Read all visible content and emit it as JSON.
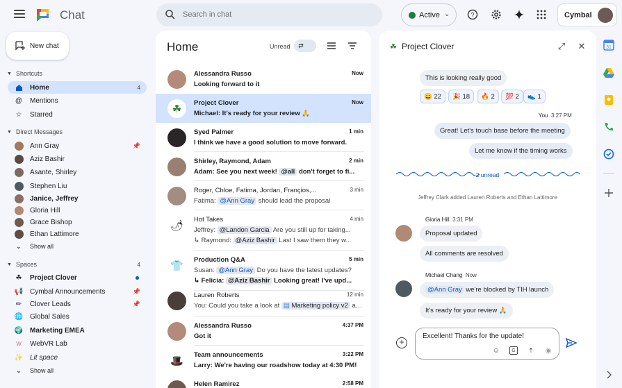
{
  "header": {
    "app_title": "Chat",
    "search_placeholder": "Search in chat",
    "status": "Active",
    "brand": "Cymbal",
    "icons": [
      "menu-icon",
      "help-icon",
      "settings-icon",
      "gemini-icon",
      "apps-grid-icon"
    ]
  },
  "sidebar": {
    "new_chat": "New chat",
    "shortcuts_label": "Shortcuts",
    "shortcuts": [
      {
        "label": "Home",
        "count": "4",
        "active": true
      },
      {
        "label": "Mentions"
      },
      {
        "label": "Starred"
      }
    ],
    "dm_label": "Direct Messages",
    "dms": [
      {
        "label": "Ann Gray",
        "pinned": true
      },
      {
        "label": "Aziz Bashir"
      },
      {
        "label": "Asante, Shirley"
      },
      {
        "label": "Stephen Liu"
      },
      {
        "label": "Janice, Jeffrey",
        "bold": true
      },
      {
        "label": "Gloria Hill"
      },
      {
        "label": "Grace Bishop"
      },
      {
        "label": "Ethan Lattimore"
      },
      {
        "label": "Show all"
      }
    ],
    "spaces_label": "Spaces",
    "spaces_count": "4",
    "spaces": [
      {
        "label": "Project Clover",
        "bold": true
      },
      {
        "label": "Cymbal Announcements",
        "pinned": true
      },
      {
        "label": "Clover Leads",
        "pinned": true
      },
      {
        "label": "Global Sales"
      },
      {
        "label": "Marketing EMEA",
        "bold": true
      },
      {
        "label": "WebVR Lab"
      },
      {
        "label": "Lit space",
        "italic": true
      },
      {
        "label": "Show all"
      }
    ]
  },
  "home": {
    "title": "Home",
    "unread_label": "Unread",
    "conversations": [
      {
        "name": "Alessandra Russo",
        "time": "Now",
        "snippet": "Looking forward to it",
        "bold": true
      },
      {
        "name": "Project Clover",
        "time": "Now",
        "snippet": "Michael: It's ready for your review 🙏",
        "bold": true
      },
      {
        "name": "Syed Palmer",
        "time": "1 min",
        "snippet": "I think we have a good solution to move forward.",
        "bold": true
      },
      {
        "name": "Shirley, Raymond, Adam",
        "time": "2 min",
        "snippet_prefix": "Adam: See you next week! ",
        "snippet_mention": "@all",
        "snippet_suffix": " don't forget to fi...",
        "bold": true
      },
      {
        "name": "Roger, Chloe, Fatima, Jordan, Françios,...",
        "time": "3 min",
        "snippet_prefix": "Fatima: ",
        "snippet_mention": "@Ann Gray",
        "snippet_suffix": " should lead the proposal"
      },
      {
        "name": "Hot Takes",
        "time": "4 min",
        "snippet_prefix": "Jeffrey: ",
        "snippet_mention": "@Landon Garcia",
        "snippet_suffix": " Are you still up for taking...",
        "snippet2_prefix": "Raymond: ",
        "snippet2_mention": "@Aziz Bashir",
        "snippet2_suffix": " Last I saw them they w..."
      },
      {
        "name": "Production Q&A",
        "time": "5 min",
        "snippet_prefix": "Susan: ",
        "snippet_mention": "@Ann Gray",
        "snippet_suffix": " Do you have the latest updates?",
        "snippet2_prefix": "Felicia: ",
        "snippet2_mention": "@Aziz Bashir",
        "snippet2_suffix": " Looking great! I've upd...",
        "bold": true
      },
      {
        "name": "Lauren Roberts",
        "time": "12 min",
        "snippet_prefix": "You: Could you take a look at ",
        "snippet_mention": "Marketing policy v2",
        "snippet_suffix": " an..."
      },
      {
        "name": "Alessandra Russo",
        "time": "4:37 PM",
        "snippet": "Got it",
        "bold": true
      },
      {
        "name": "Team announcements",
        "time": "3:22 PM",
        "snippet": "Larry: We're having our roadshow today at 4:30 PM!",
        "bold": true
      },
      {
        "name": "Helen Ramirez",
        "time": "2:58 PM",
        "snippet": ""
      }
    ]
  },
  "chat": {
    "title": "Project Clover",
    "messages": {
      "m1": "This is looking really good",
      "reactions": [
        {
          "emoji": "😀",
          "count": "22"
        },
        {
          "emoji": "🎉",
          "count": "18"
        },
        {
          "emoji": "🔥",
          "count": "2"
        },
        {
          "emoji": "💯",
          "count": "2"
        },
        {
          "emoji": "👟",
          "count": "1"
        }
      ],
      "me_label": "You",
      "me_time": "3:27 PM",
      "me1": "Great! Let's touch base before the meeting",
      "me2": "Let me know if the timing works",
      "unread": "2 unread",
      "system": "Jeffrey Clark added Lauren Roberts and Ethan Lattimore",
      "gloria_name": "Gloria Hill",
      "gloria_time": "3:31 PM",
      "g1": "Proposal updated",
      "g2": "All comments are resolved",
      "michael_name": "Michael Chang",
      "michael_time": "Now",
      "mc1_mention": "@Ann Gray",
      "mc1_suffix": " we're blocked by TIH launch",
      "mc2": "It's ready for your review 🙏"
    },
    "composer_text": "Excellent! Thanks for the update!"
  },
  "colors": {
    "accent": "#0b57d0",
    "selected": "#d3e3fd",
    "active_status": "#188038"
  }
}
